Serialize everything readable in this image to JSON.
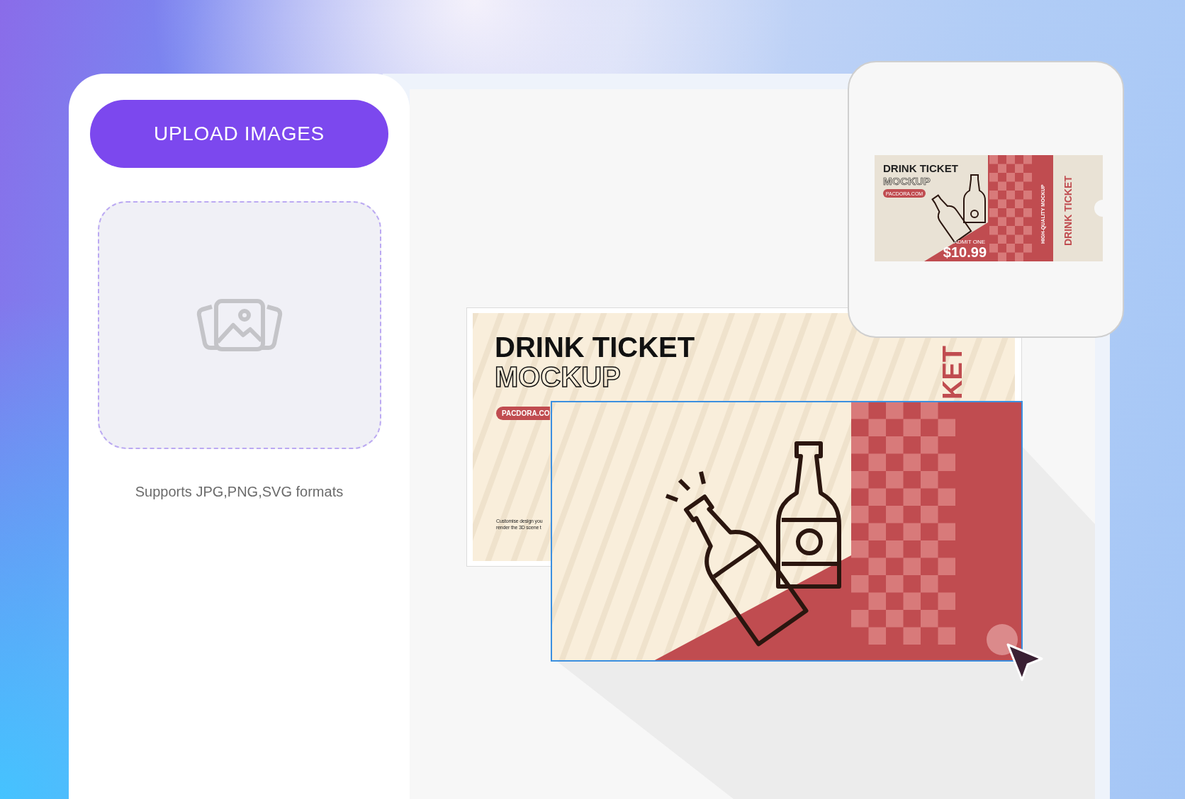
{
  "sidebar": {
    "upload_button": "UPLOAD IMAGES",
    "formats_note": "Supports JPG,PNG,SVG formats"
  },
  "canvas": {
    "ticket": {
      "title": "DRINK TICKET",
      "subtitle": "MOCKUP",
      "badge": "PACDORA.CO",
      "body_lines": [
        "Customise design you",
        "render the 3D scene t"
      ],
      "side_text": "KET"
    }
  },
  "preview": {
    "title": "DRINK TICKET",
    "subtitle": "MOCKUP",
    "badge": "PACDORA.COM",
    "admit": "ADMIT ONE",
    "price": "$10.99",
    "tagline": "HIGH-QUALITY MOCKUP",
    "stub_text": "DRINK TICKET"
  }
}
